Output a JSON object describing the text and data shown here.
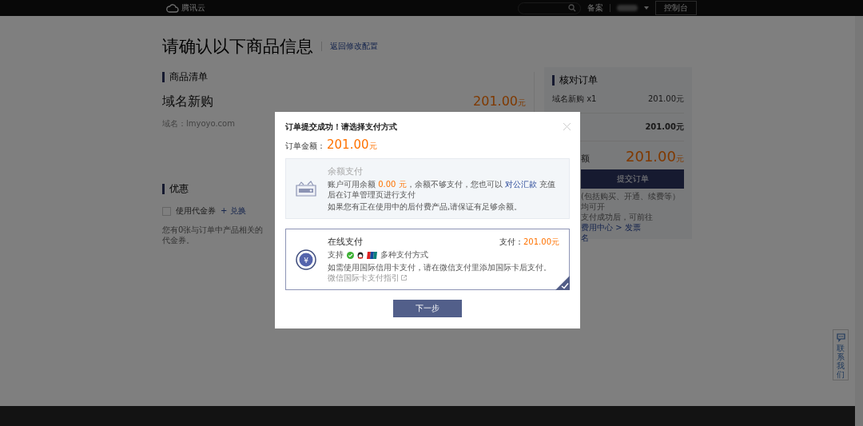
{
  "topbar": {
    "brand": "腾讯云",
    "links": [
      "备案"
    ],
    "console_button": "控制台"
  },
  "page": {
    "title": "请确认以下商品信息",
    "back_link": "返回修改配置"
  },
  "goods": {
    "heading": "商品清单",
    "product": "域名新购",
    "price": "201.00",
    "currency": "元",
    "domain": "域名：lmyoyo.com"
  },
  "discount": {
    "heading": "优惠",
    "voucher": {
      "label": "使用代金券",
      "checked": false
    },
    "redeem_link": "+ 兑换",
    "note": "您有0张与订单中产品相关的代金券。"
  },
  "summary": {
    "heading": "核对订单",
    "item_label": "域名新购 x1",
    "item_value": "201.00元",
    "subtotal": "201.00元",
    "total_label": "额",
    "total": "201.00",
    "currency": "元",
    "submit_button": "提交订单",
    "notes": [
      "(包括购买、开通、续费等）均可开",
      "支付成功后，可前往"
    ],
    "fee_link": "费用中心 > 发票",
    "fee_link_tail": "名"
  },
  "modal": {
    "title": "订单提交成功！请选择支付方式",
    "amount_label": "订单金额：",
    "amount": "201.00",
    "currency": "元",
    "methods": [
      {
        "kind": "balance",
        "selected": false,
        "disabled": true,
        "title": "余额支付",
        "line_parts": [
          {
            "kind": "plain",
            "text": "账户可用余额 "
          },
          {
            "kind": "amount",
            "text": "0.00 元"
          },
          {
            "kind": "plain",
            "text": "，余额不够支付，您也可以 "
          },
          {
            "kind": "link",
            "text": "对公汇款"
          },
          {
            "kind": "plain",
            "text": " 充值后在订单管理页进行支付"
          }
        ],
        "note": "如果您有正在使用中的后付费产品,请保证有足够余额。"
      },
      {
        "kind": "online",
        "selected": true,
        "disabled": false,
        "symbol": "¥",
        "title": "在线支付",
        "price_label": "支付：",
        "price": "201.00元",
        "support": "支持",
        "extra": "多种支付方式",
        "note": "如需使用国际信用卡支付，请在微信支付里添加国际卡后支付。",
        "guide_link": "微信国际卡支付指引"
      }
    ],
    "next_button": "下一步"
  },
  "contact": {
    "label": "联系我们"
  }
}
